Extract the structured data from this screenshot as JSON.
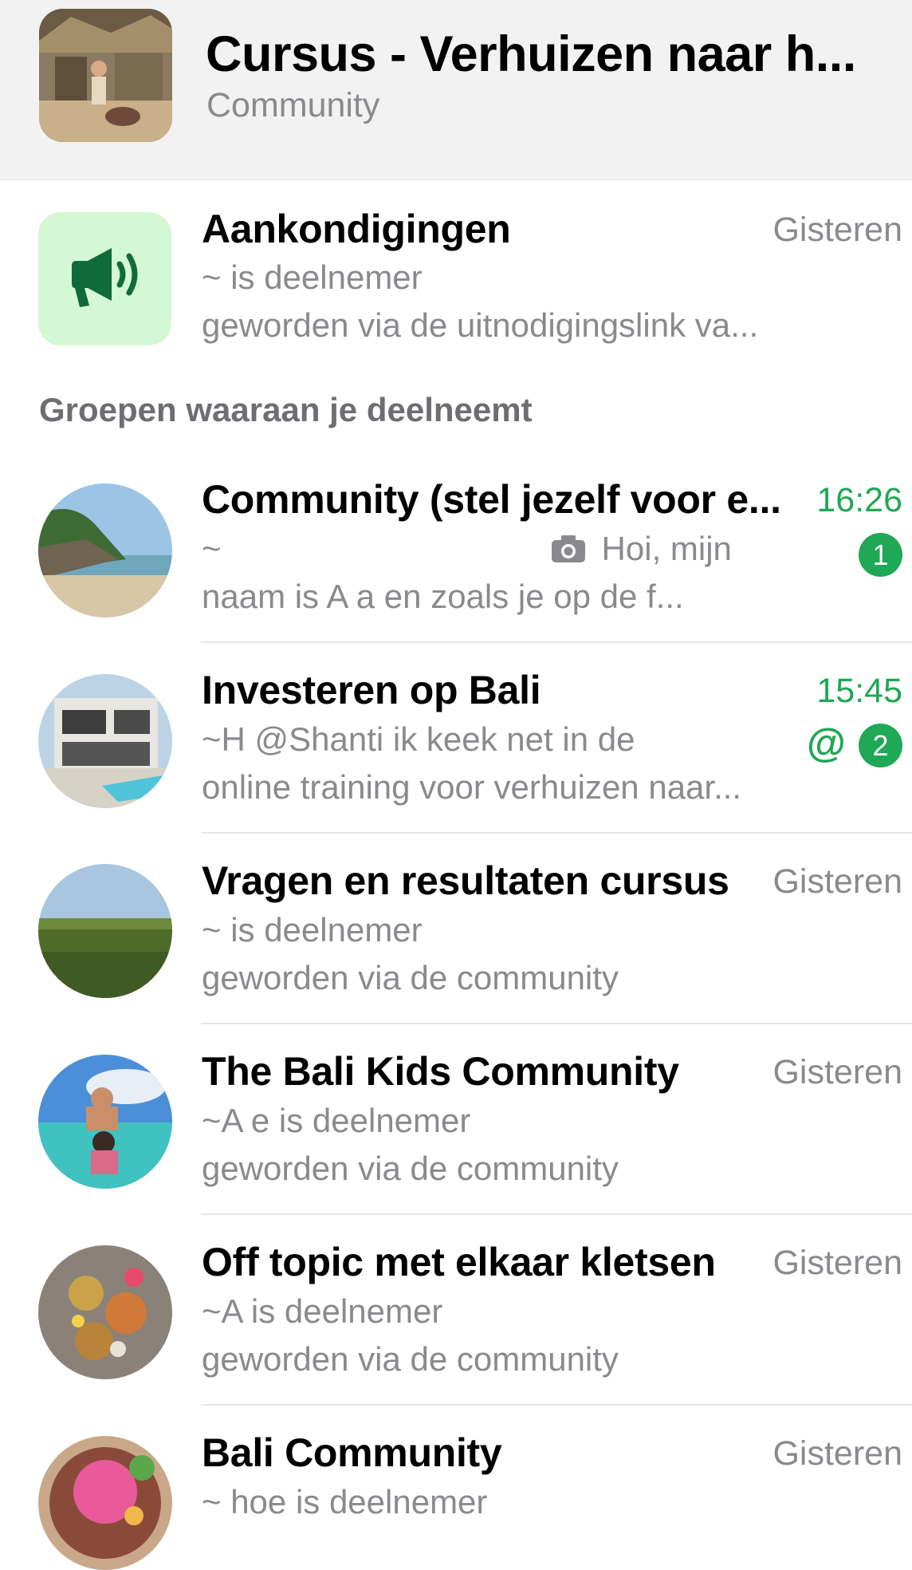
{
  "header": {
    "title": "Cursus - Verhuizen naar h...",
    "subtitle": "Community"
  },
  "announcement": {
    "title": "Aankondigingen",
    "time": "Gisteren",
    "line1": "~ is deelnemer",
    "line2": "geworden via de uitnodigingslink va..."
  },
  "section_label": "Groepen waaraan je deelneemt",
  "groups": [
    {
      "title": "Community (stel jezelf voor e...",
      "time": "16:26",
      "line1_prefix": "~",
      "line1_text": "Hoi, mijn",
      "line2": "naam is A a en zoals je op de f...",
      "badge": "1"
    },
    {
      "title": "Investeren op Bali",
      "time": "15:45",
      "line1": "~H @Shanti ik keek net in de",
      "line2": "online training voor verhuizen naar...",
      "mention": "@",
      "badge": "2"
    },
    {
      "title": "Vragen en resultaten cursus",
      "time": "Gisteren",
      "line1": "~ is deelnemer",
      "line2": "geworden via de community"
    },
    {
      "title": "The Bali Kids Community",
      "time": "Gisteren",
      "line1": "~A e is deelnemer",
      "line2": "geworden via de community"
    },
    {
      "title": "Off topic met elkaar kletsen",
      "time": "Gisteren",
      "line1": "~A is deelnemer",
      "line2": "geworden via de community"
    },
    {
      "title": "Bali Community",
      "time": "Gisteren",
      "line1": "~ hoe is deelnemer"
    }
  ],
  "icons": {
    "announcement": "megaphone-icon",
    "photo": "camera-icon"
  },
  "colors": {
    "accent_green": "#1fa855",
    "announce_bg": "#d4f8d4",
    "muted_text": "#8a8a8e"
  }
}
